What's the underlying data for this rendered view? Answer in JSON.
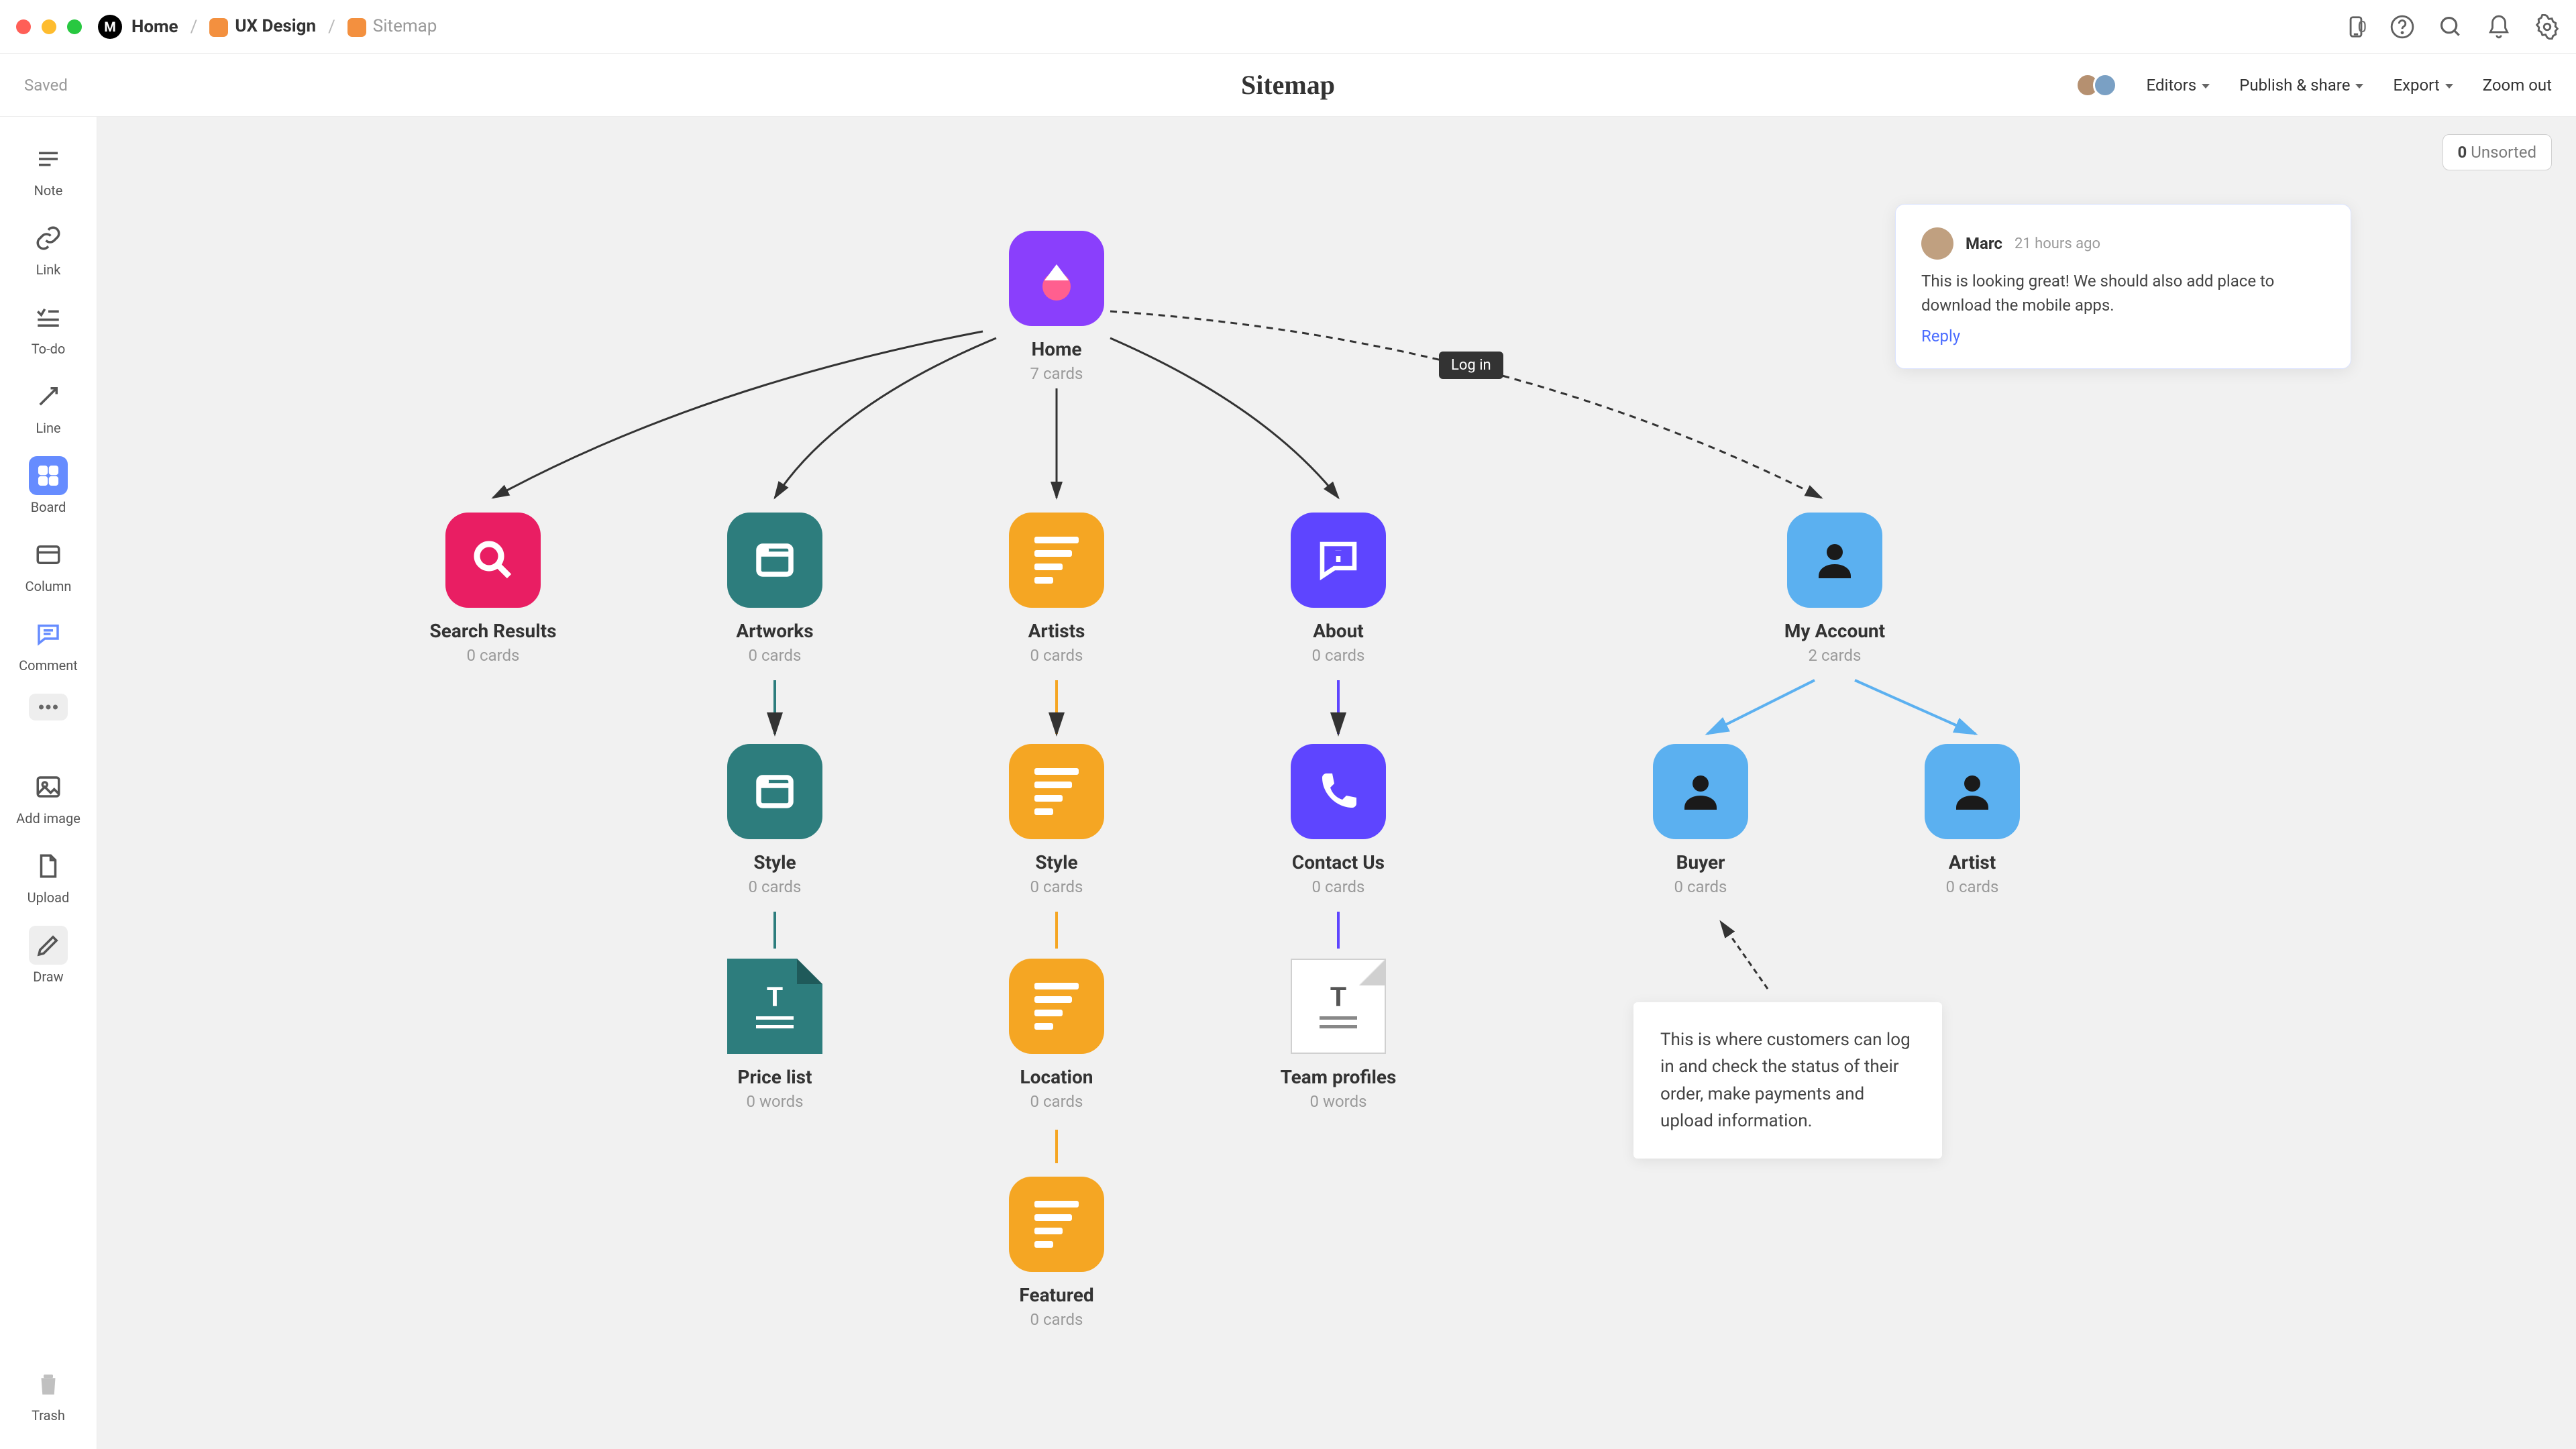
{
  "breadcrumbs": {
    "home": "Home",
    "ux": "UX Design",
    "sitemap": "Sitemap"
  },
  "topIcons": {
    "batteryCount": "0"
  },
  "second": {
    "saved": "Saved",
    "title": "Sitemap",
    "editors": "Editors",
    "publish": "Publish & share",
    "export": "Export",
    "zoomout": "Zoom out"
  },
  "unsorted": {
    "count": "0",
    "label": "Unsorted"
  },
  "tools": {
    "note": "Note",
    "link": "Link",
    "todo": "To-do",
    "line": "Line",
    "board": "Board",
    "column": "Column",
    "comment": "Comment",
    "addimage": "Add image",
    "upload": "Upload",
    "draw": "Draw",
    "trash": "Trash"
  },
  "nodes": {
    "home": {
      "title": "Home",
      "sub": "7 cards"
    },
    "search": {
      "title": "Search Results",
      "sub": "0 cards"
    },
    "artworks": {
      "title": "Artworks",
      "sub": "0 cards"
    },
    "artists": {
      "title": "Artists",
      "sub": "0 cards"
    },
    "about": {
      "title": "About",
      "sub": "0 cards"
    },
    "myaccount": {
      "title": "My Account",
      "sub": "2 cards"
    },
    "style1": {
      "title": "Style",
      "sub": "0 cards"
    },
    "style2": {
      "title": "Style",
      "sub": "0 cards"
    },
    "contact": {
      "title": "Contact Us",
      "sub": "0 cards"
    },
    "buyer": {
      "title": "Buyer",
      "sub": "0 cards"
    },
    "artist": {
      "title": "Artist",
      "sub": "0 cards"
    },
    "pricelist": {
      "title": "Price list",
      "sub": "0 words"
    },
    "location": {
      "title": "Location",
      "sub": "0 cards"
    },
    "teamprofiles": {
      "title": "Team profiles",
      "sub": "0 words"
    },
    "featured": {
      "title": "Featured",
      "sub": "0 cards"
    }
  },
  "loginLabel": "Log in",
  "comment": {
    "name": "Marc",
    "time": "21 hours ago",
    "body": "This is looking great! We should also add place to download the mobile apps.",
    "reply": "Reply"
  },
  "note": "This is where customers can log in and check the status of their order, make payments and upload information."
}
